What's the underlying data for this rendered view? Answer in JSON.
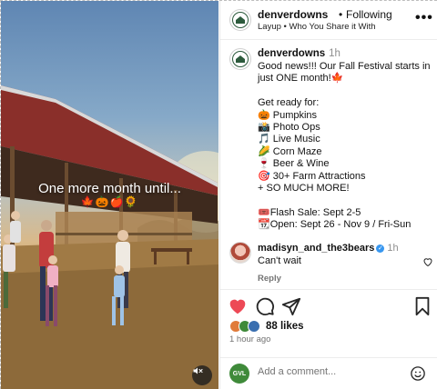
{
  "media": {
    "overlay_text": "One more month until...",
    "overlay_emoji": "🍁🎃🍎🌻"
  },
  "header": {
    "username": "denverdowns",
    "separator": "•",
    "follow_label": "Following",
    "audio": "Layup • Who You Share it With",
    "more_icon": "more-horizontal-icon"
  },
  "caption": {
    "username": "denverdowns",
    "time": "1h",
    "lines": [
      "Good news!!! Our Fall Festival starts in",
      "just ONE month!🍁",
      "",
      "Get ready for:",
      "🎃 Pumpkins",
      "📸 Photo Ops",
      "🎵 Live Music",
      "🌽 Corn Maze",
      "🍷 Beer & Wine",
      "🎯 30+ Farm Attractions",
      "+ SO MUCH MORE!",
      "",
      "🎟️Flash Sale: Sept 2-5",
      "📆Open: Sept 26 - Nov 9 / Fri-Sun"
    ]
  },
  "comment": {
    "username": "madisyn_and_the3bears",
    "verified": "✓",
    "time": "1h",
    "text": "Can't wait",
    "reply_label": "Reply"
  },
  "actions": {
    "likes": "88 likes",
    "time_ago": "1 hour ago",
    "colors": {
      "like": "#ed4956"
    }
  },
  "add_comment": {
    "avatar_text": "GVL",
    "placeholder": "Add a comment..."
  }
}
